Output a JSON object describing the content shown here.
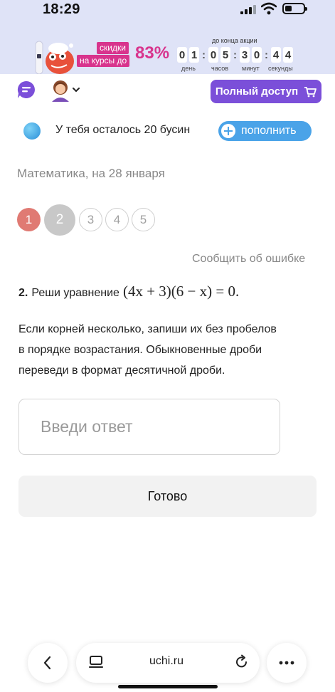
{
  "status_bar": {
    "time": "18:29"
  },
  "promo": {
    "label_line1": "скидки",
    "label_line2": "на курсы до",
    "percent": "83%",
    "countdown_title": "до конца акции",
    "digits": [
      "0",
      "1",
      "0",
      "5",
      "3",
      "0",
      "4",
      "4"
    ],
    "units": [
      "день",
      "часов",
      "минут",
      "секунды"
    ]
  },
  "header": {
    "full_access_label": "Полный доступ"
  },
  "beads": {
    "text": "У тебя осталось 20 бусин",
    "topup_label": "пополнить"
  },
  "lesson": {
    "subject": "Математика, на 28 января",
    "steps": [
      "1",
      "2",
      "3",
      "4",
      "5"
    ],
    "current_step": 2,
    "report_label": "Сообщить об ошибке"
  },
  "task": {
    "number": "2.",
    "prompt": "Реши уравнение",
    "equation": "(4x + 3)(6 − x) = 0.",
    "instruction_lines": [
      "Если корней несколько, запиши их без пробелов",
      "в порядке возрастания. Обыкновенные дроби",
      "переведи в формат десятичной дроби."
    ]
  },
  "answer": {
    "placeholder": "Введи ответ"
  },
  "done_label": "Готово",
  "browser": {
    "url": "uchi.ru"
  },
  "colors": {
    "accent_purple": "#7b4fd9",
    "accent_blue": "#4aa3e8",
    "promo_pink": "#d8348d",
    "step_done": "#e07a73"
  }
}
